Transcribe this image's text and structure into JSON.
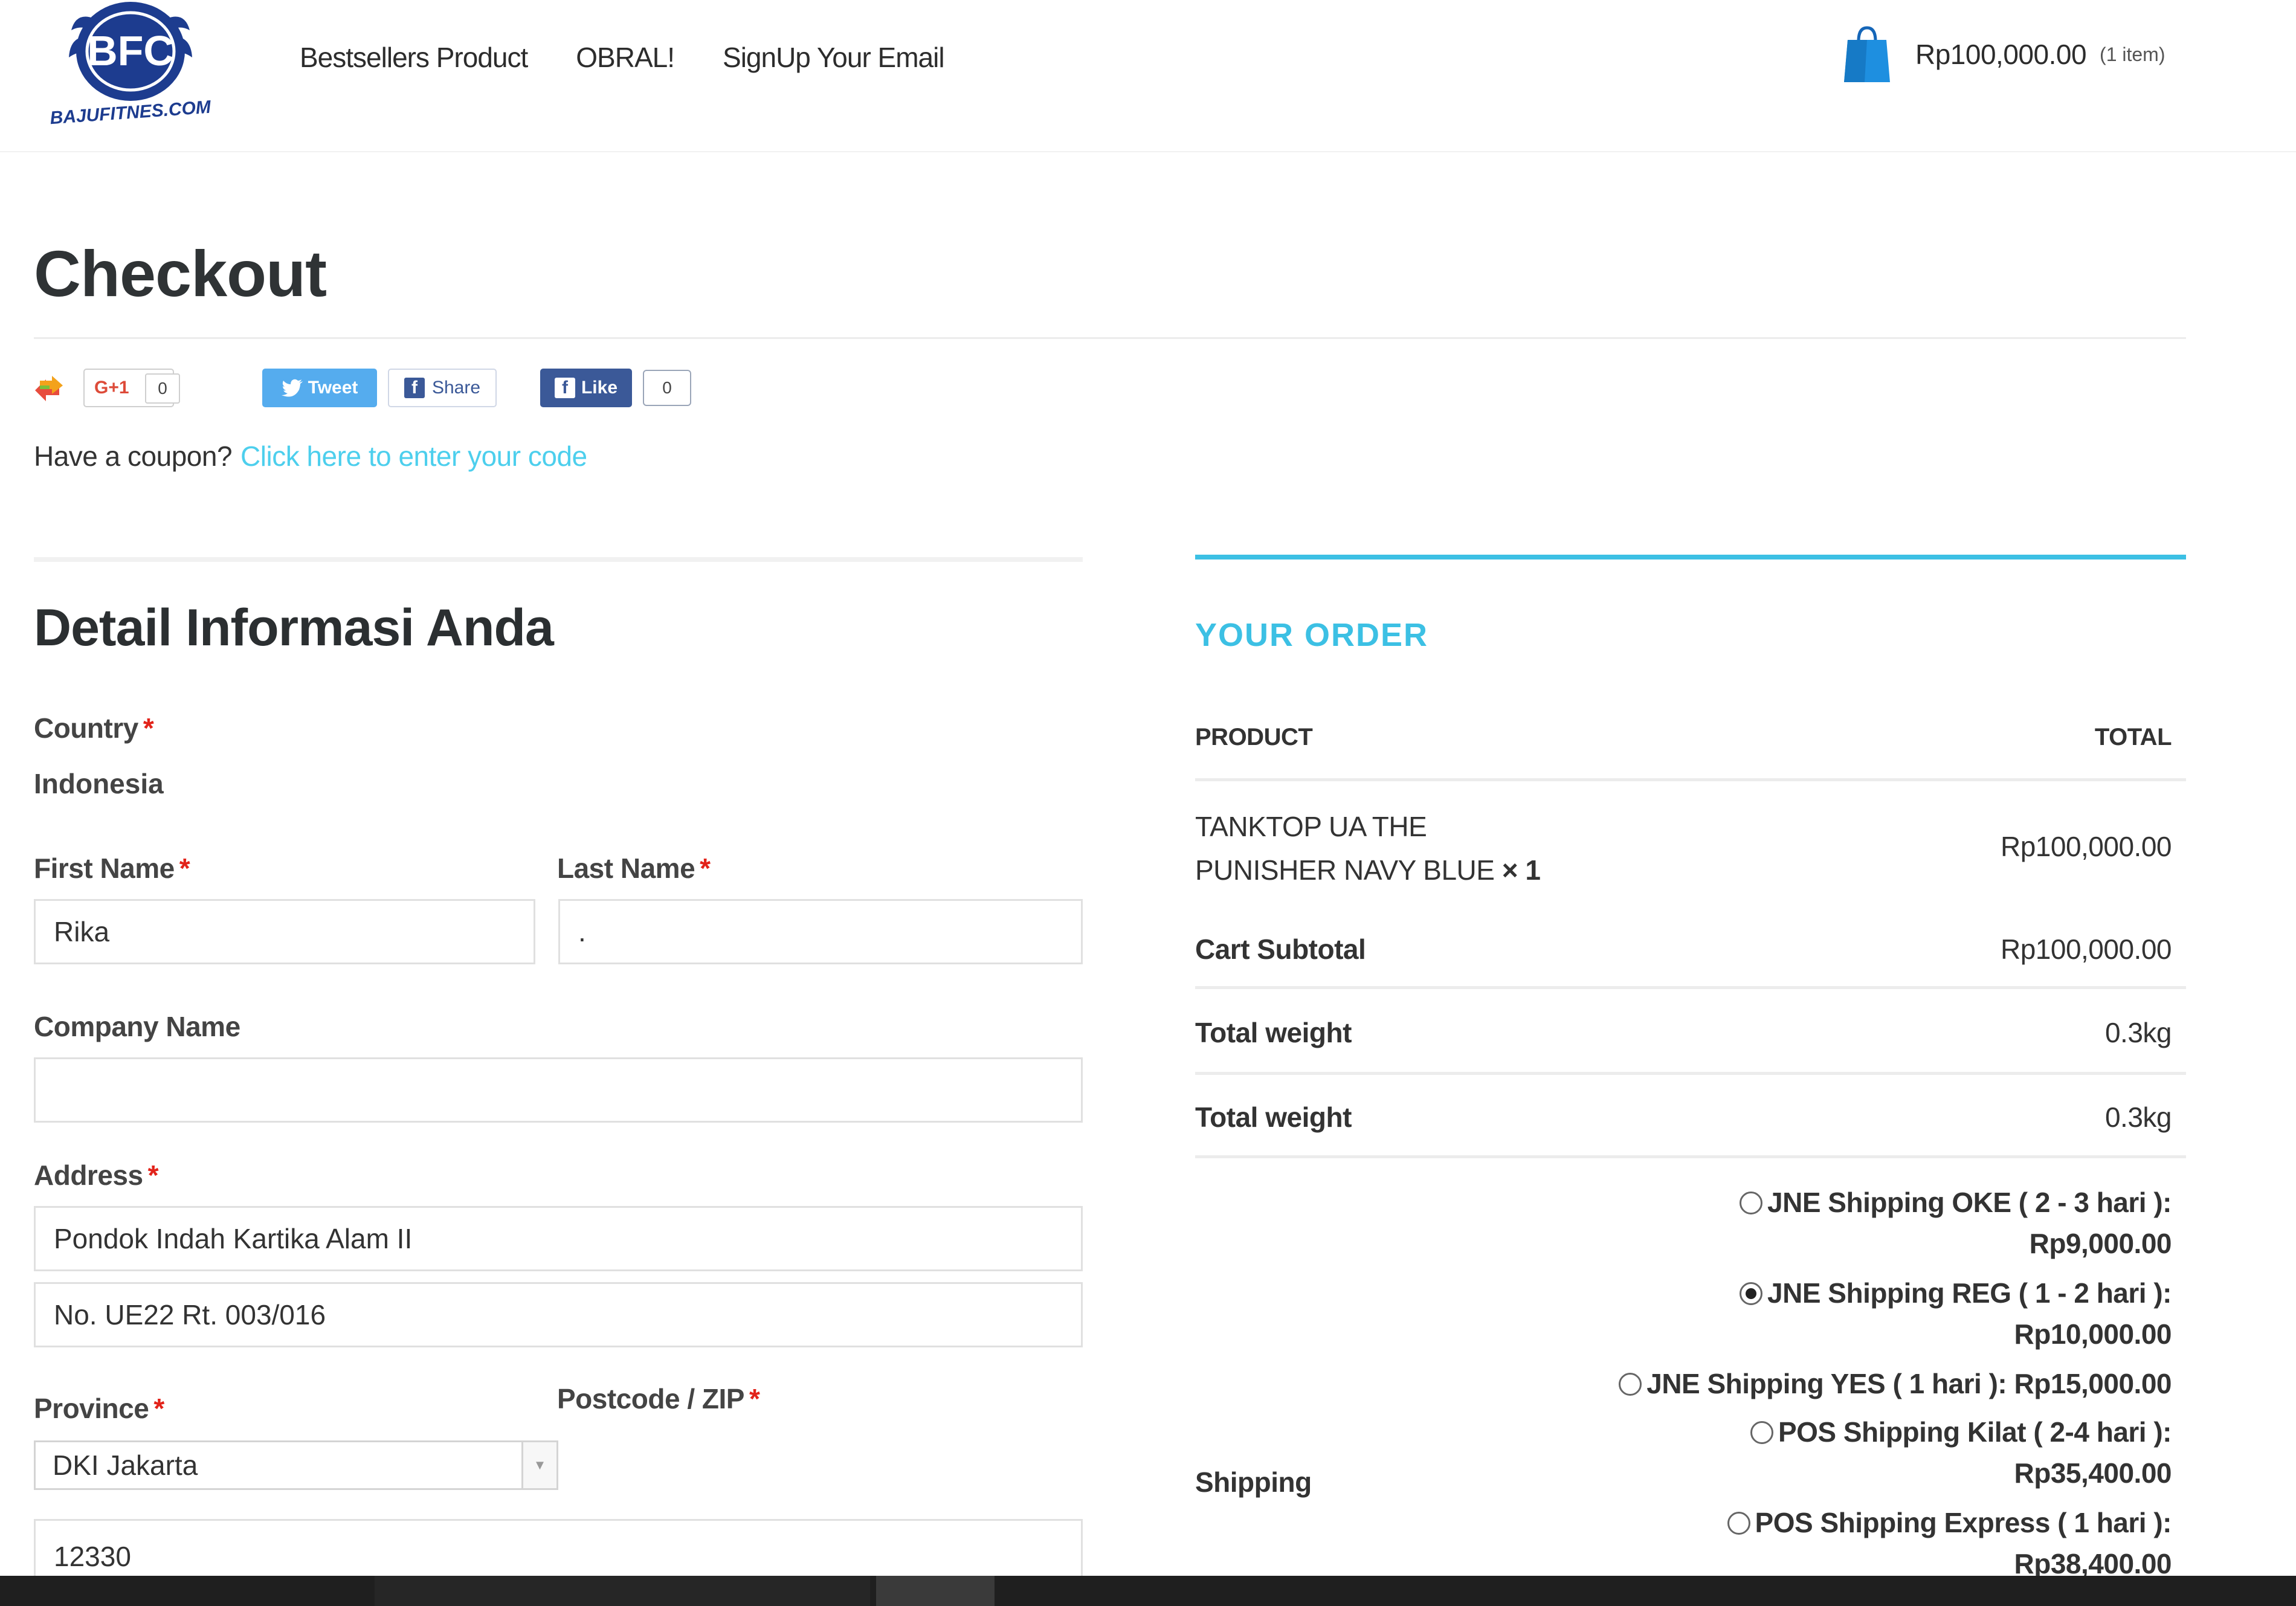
{
  "header": {
    "logo": {
      "text": "BFC",
      "subtext": "BAJUFITNES.COM"
    },
    "nav": [
      "Bestsellers Product",
      "OBRAL!",
      "SignUp Your Email"
    ],
    "cart": {
      "amount": "Rp100,000.00",
      "count": "(1 item)"
    }
  },
  "page": {
    "title": "Checkout"
  },
  "social": {
    "gplus_label": "G+1",
    "gplus_count": "0",
    "tweet_label": "Tweet",
    "share_label": "Share",
    "like_label": "Like",
    "like_count": "0"
  },
  "coupon": {
    "text": "Have a coupon?",
    "link": "Click here to enter your code"
  },
  "billing": {
    "title": "Detail Informasi Anda",
    "country_label": "Country",
    "country_value": "Indonesia",
    "first_name_label": "First Name",
    "first_name_value": "Rika",
    "last_name_label": "Last Name",
    "last_name_value": ".",
    "company_label": "Company Name",
    "company_value": "",
    "address_label": "Address",
    "address_1": "Pondok Indah Kartika Alam II",
    "address_2": "No. UE22 Rt. 003/016",
    "province_label": "Province",
    "province_value": "DKI Jakarta",
    "postcode_label": "Postcode / ZIP",
    "postcode_value": "12330",
    "required_mark": "*"
  },
  "order": {
    "title": "YOUR ORDER",
    "col_product": "PRODUCT",
    "col_total": "TOTAL",
    "item_line1": "TANKTOP UA THE",
    "item_line2": "PUNISHER NAVY BLUE",
    "item_qty": "× 1",
    "item_total": "Rp100,000.00",
    "subtotal_label": "Cart Subtotal",
    "subtotal_value": "Rp100,000.00",
    "weight_label_1": "Total weight",
    "weight_value_1": "0.3kg",
    "weight_label_2": "Total weight",
    "weight_value_2": "0.3kg",
    "shipping_label": "Shipping",
    "shipping_options": [
      {
        "line1": "JNE Shipping OKE ( 2 - 3 hari ):",
        "line2": "Rp9,000.00",
        "checked": false
      },
      {
        "line1": "JNE Shipping REG ( 1 - 2 hari ):",
        "line2": "Rp10,000.00",
        "checked": true
      },
      {
        "line1": "JNE Shipping YES ( 1 hari ): Rp15,000.00",
        "line2": "",
        "checked": false
      },
      {
        "line1": "POS Shipping Kilat ( 2-4 hari ):",
        "line2": "Rp35,400.00",
        "checked": false
      },
      {
        "line1": "POS Shipping Express ( 1 hari ):",
        "line2": "Rp38,400.00",
        "checked": false
      }
    ]
  },
  "colors": {
    "accent": "#3cc0e4",
    "link": "#4dcfed",
    "required": "#e2231a",
    "logo_blue": "#1d3c8f"
  }
}
